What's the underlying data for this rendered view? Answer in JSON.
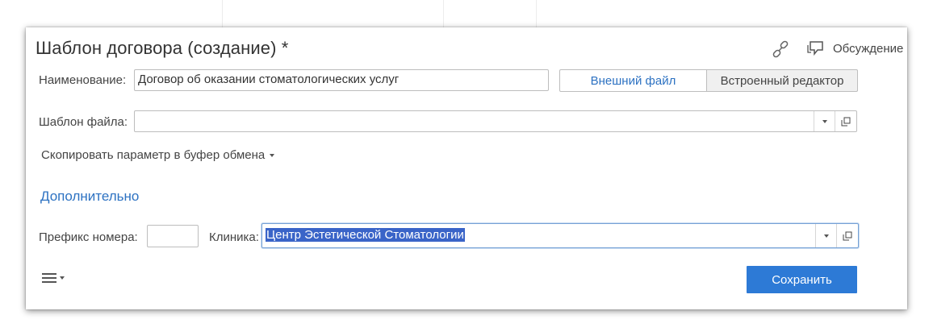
{
  "form": {
    "title": "Шаблон договора (создание) *",
    "discussion_label": "Обсуждение",
    "name_label": "Наименование:",
    "name_value": "Договор об оказании стоматологических услуг",
    "external_file_button": "Внешний файл",
    "builtin_editor_button": "Встроенный редактор",
    "file_template_label": "Шаблон файла:",
    "file_template_value": "",
    "copy_param_label": "Скопировать параметр в буфер обмена",
    "section_title": "Дополнительно",
    "prefix_label": "Префикс номера:",
    "prefix_value": "",
    "clinic_label": "Клиника:",
    "clinic_value": "Центр Эстетической Стоматологии",
    "save_button": "Сохранить"
  },
  "icons": {
    "link": "link-icon",
    "discussion": "comment-icon",
    "dropdown": "chevron-down-icon",
    "open": "open-window-icon",
    "menu": "hamburger-menu-icon"
  },
  "colors": {
    "accent": "#2d72c2",
    "save_button_bg": "#2d7ad6",
    "selection_bg": "#3a64c8"
  }
}
